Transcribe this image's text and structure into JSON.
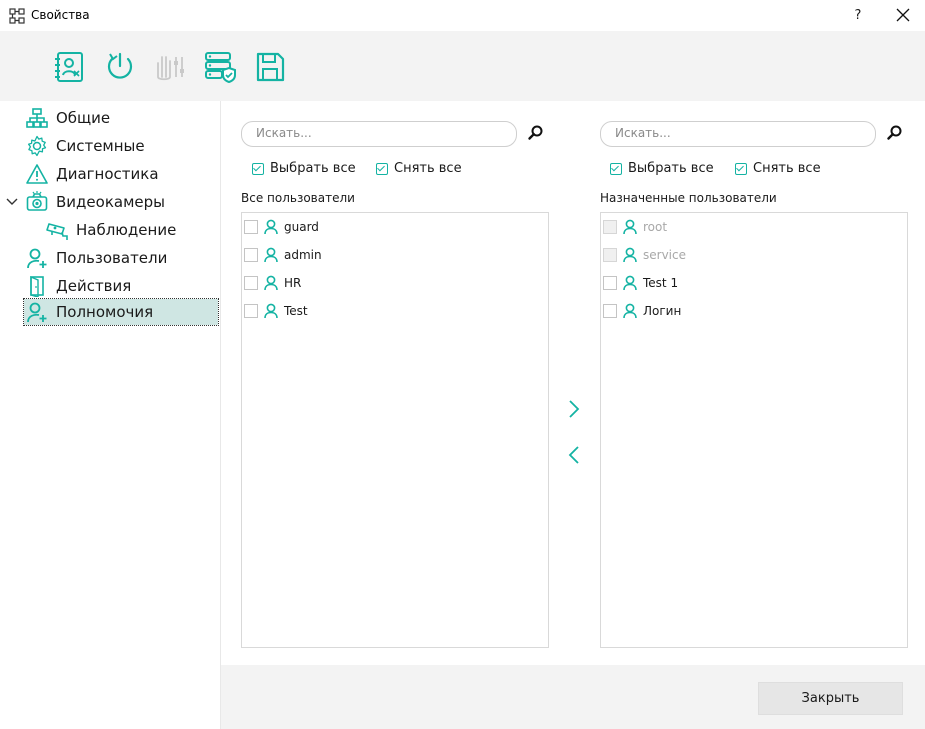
{
  "window": {
    "title": "Свойства",
    "help": "?"
  },
  "toolbar": {
    "buttons": [
      "contact-card-icon",
      "power-icon",
      "hand-sliders-icon",
      "server-shield-icon",
      "save-icon"
    ]
  },
  "sidebar": {
    "items": [
      {
        "label": "Общие",
        "icon": "network-icon"
      },
      {
        "label": "Системные",
        "icon": "gear-icon"
      },
      {
        "label": "Диагностика",
        "icon": "warning-icon"
      },
      {
        "label": "Видеокамеры",
        "icon": "camera-icon",
        "expanded": true
      },
      {
        "label": "Наблюдение",
        "icon": "cctv-icon"
      },
      {
        "label": "Пользователи",
        "icon": "user-add-icon"
      },
      {
        "label": "Действия",
        "icon": "door-icon"
      },
      {
        "label": "Полномочия",
        "icon": "user-add-icon",
        "selected": true
      }
    ]
  },
  "left_panel": {
    "search_placeholder": "Искать...",
    "select_all": "Выбрать все",
    "deselect_all": "Снять все",
    "list_title": "Все пользователи",
    "users": [
      "guard",
      "admin",
      "HR",
      "Test"
    ]
  },
  "right_panel": {
    "search_placeholder": "Искать...",
    "select_all": "Выбрать все",
    "deselect_all": "Снять все",
    "list_title": "Назначенные пользователи",
    "users": [
      {
        "name": "root",
        "disabled": true
      },
      {
        "name": "service",
        "disabled": true
      },
      {
        "name": "Test 1",
        "disabled": false
      },
      {
        "name": "Логин",
        "disabled": false
      }
    ]
  },
  "footer": {
    "close_label": "Закрыть"
  },
  "colors": {
    "accent": "#14b3a3",
    "selected_bg": "#cfe6e3",
    "panel_bg": "#f3f3f3"
  }
}
